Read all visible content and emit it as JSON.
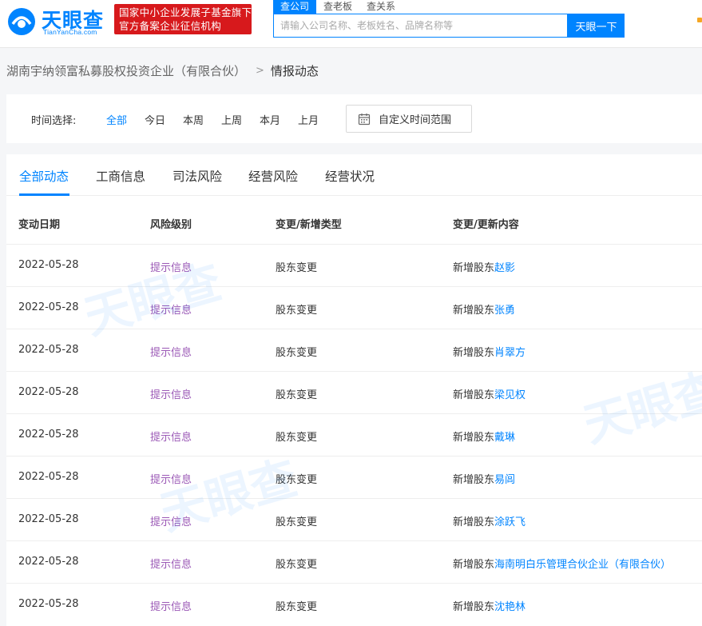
{
  "brand": {
    "logo_text": "天眼查",
    "logo_sub": "TianYanCha.com",
    "badge_line1": "国家中小企业发展子基金旗下",
    "badge_line2": "官方备案企业征信机构",
    "accent_color": "#0084ff",
    "badge_color": "#d7191c"
  },
  "search": {
    "tabs": [
      "查公司",
      "查老板",
      "查关系"
    ],
    "active_tab": "查公司",
    "placeholder": "请输入公司名称、老板姓名、品牌名称等",
    "button_label": "天眼一下"
  },
  "breadcrumb": {
    "company": "湖南宇纳领富私募股权投资企业（有限合伙）",
    "separator": ">",
    "current": "情报动态"
  },
  "filter": {
    "label": "时间选择:",
    "options": [
      "全部",
      "今日",
      "本周",
      "上周",
      "本月",
      "上月"
    ],
    "active": "全部",
    "custom_range_label": "自定义时间范围",
    "custom_range_icon": "calendar-icon"
  },
  "tabs": {
    "items": [
      "全部动态",
      "工商信息",
      "司法风险",
      "经营风险",
      "经营状况"
    ],
    "active": "全部动态"
  },
  "table": {
    "headers": [
      "变动日期",
      "风险级别",
      "变更/新增类型",
      "变更/更新内容"
    ],
    "risk_color": "#9b59b6",
    "rows": [
      {
        "date": "2022-05-28",
        "risk": "提示信息",
        "type": "股东变更",
        "prefix": "新增股东",
        "name": "赵影"
      },
      {
        "date": "2022-05-28",
        "risk": "提示信息",
        "type": "股东变更",
        "prefix": "新增股东",
        "name": "张勇"
      },
      {
        "date": "2022-05-28",
        "risk": "提示信息",
        "type": "股东变更",
        "prefix": "新增股东",
        "name": "肖翠方"
      },
      {
        "date": "2022-05-28",
        "risk": "提示信息",
        "type": "股东变更",
        "prefix": "新增股东",
        "name": "梁见权"
      },
      {
        "date": "2022-05-28",
        "risk": "提示信息",
        "type": "股东变更",
        "prefix": "新增股东",
        "name": "戴琳"
      },
      {
        "date": "2022-05-28",
        "risk": "提示信息",
        "type": "股东变更",
        "prefix": "新增股东",
        "name": "易闾"
      },
      {
        "date": "2022-05-28",
        "risk": "提示信息",
        "type": "股东变更",
        "prefix": "新增股东",
        "name": "涂跃飞"
      },
      {
        "date": "2022-05-28",
        "risk": "提示信息",
        "type": "股东变更",
        "prefix": "新增股东",
        "name": "海南明白乐管理合伙企业（有限合伙）"
      },
      {
        "date": "2022-05-28",
        "risk": "提示信息",
        "type": "股东变更",
        "prefix": "新增股东",
        "name": "沈艳林"
      }
    ]
  },
  "watermark": {
    "text": "天眼查",
    "sub": "TianYanCha.com"
  }
}
